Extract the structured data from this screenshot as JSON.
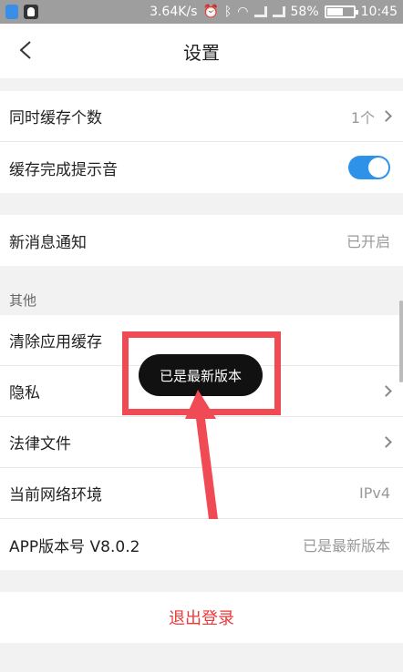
{
  "status_bar": {
    "speed": "3.64K/s",
    "battery": "58%",
    "time": "10:45"
  },
  "header": {
    "title": "设置"
  },
  "settings": {
    "cache_count": {
      "label": "同时缓存个数",
      "value": "1个"
    },
    "cache_sound": {
      "label": "缓存完成提示音",
      "enabled": true
    },
    "notification": {
      "label": "新消息通知",
      "value": "已开启"
    }
  },
  "others": {
    "section_title": "其他",
    "clear_cache": {
      "label": "清除应用缓存"
    },
    "privacy": {
      "label": "隐私"
    },
    "legal": {
      "label": "法律文件"
    },
    "network": {
      "label": "当前网络环境",
      "value": "IPv4"
    },
    "version": {
      "label": "APP版本号 V8.0.2",
      "value": "已是最新版本"
    }
  },
  "logout_label": "退出登录",
  "toast": {
    "text": "已是最新版本"
  },
  "colors": {
    "accent": "#2e93e8",
    "logout": "#e83a3a",
    "annotation": "#f04a55"
  }
}
